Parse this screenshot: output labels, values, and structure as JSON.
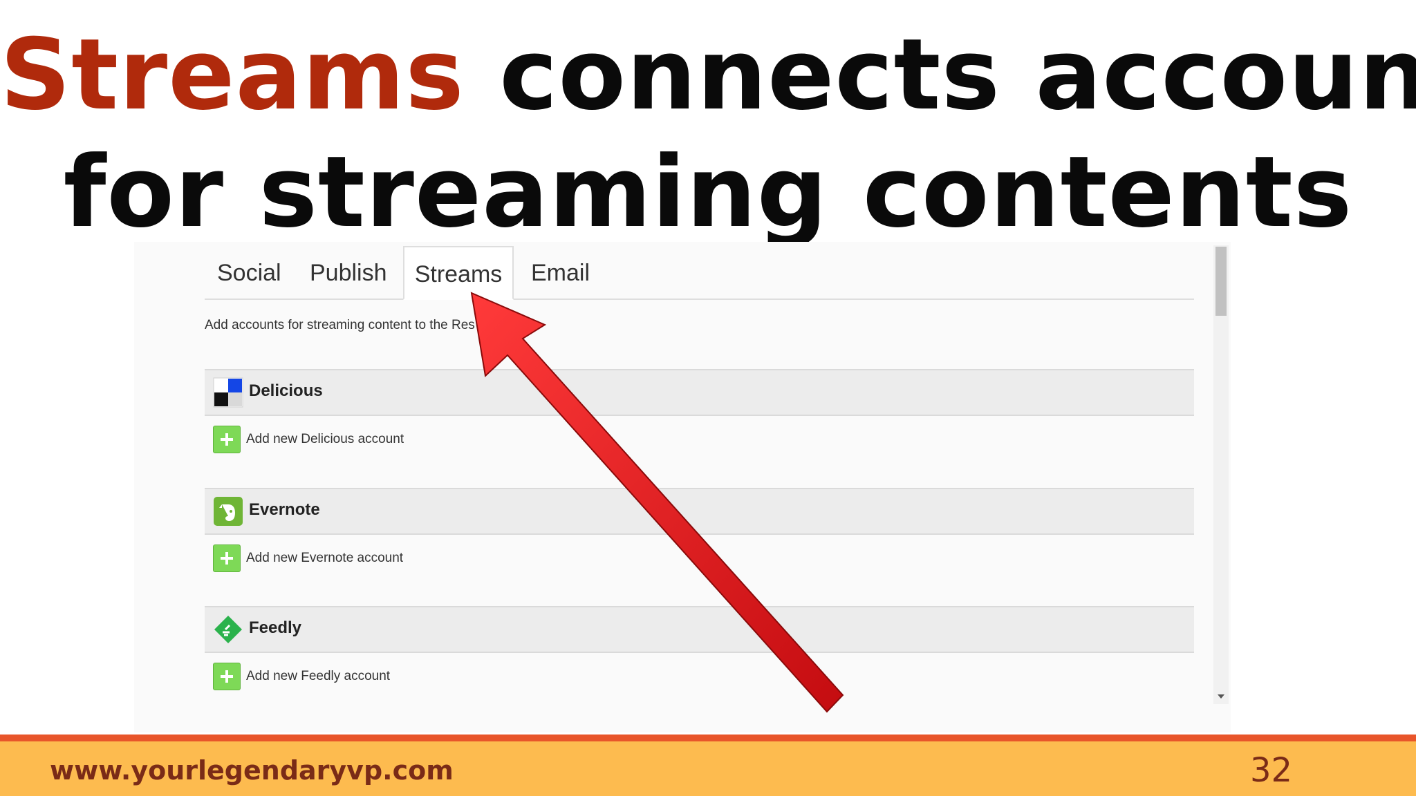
{
  "slide": {
    "title_highlight": "Streams",
    "title_rest_line1": " connects account",
    "title_line2": "for streaming contents",
    "highlight_color": "#b02a0c"
  },
  "panel": {
    "tabs": [
      "Social",
      "Publish",
      "Streams",
      "Email"
    ],
    "active_tab": "Streams",
    "intro_text": "Add accounts for streaming content to the Res",
    "sections": [
      {
        "name": "Delicious",
        "icon": "delicious-icon",
        "add_label": "Add new Delicious account"
      },
      {
        "name": "Evernote",
        "icon": "evernote-icon",
        "add_label": "Add new Evernote account"
      },
      {
        "name": "Feedly",
        "icon": "feedly-icon",
        "add_label": "Add new Feedly account"
      }
    ]
  },
  "annotation": {
    "arrow_color": "#e3141b"
  },
  "footer": {
    "url": "www.yourlegendaryvp.com",
    "page_number": "32",
    "bar_color": "#fdbb4f",
    "line_color": "#e8552a"
  }
}
